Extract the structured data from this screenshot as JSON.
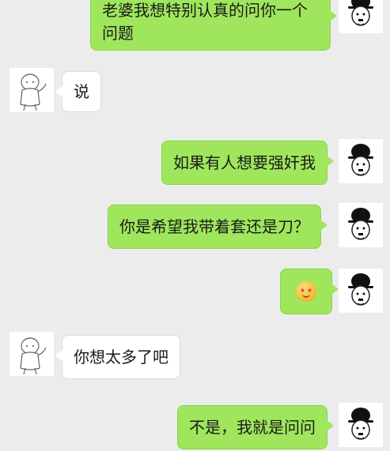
{
  "messages": [
    {
      "side": "me",
      "text": "老婆我想特别认真的问你一个问题"
    },
    {
      "side": "other",
      "text": "说"
    },
    {
      "side": "me",
      "text": "如果有人想要强奸我"
    },
    {
      "side": "me",
      "text": "你是希望我带着套还是刀？"
    },
    {
      "side": "me",
      "type": "emoji",
      "emoji": "star-struck-emoji"
    },
    {
      "side": "other",
      "text": "你想太多了吧"
    },
    {
      "side": "me",
      "text": "不是，我就是问问"
    }
  ],
  "avatars": {
    "me": "chaplin-avatar",
    "other": "sketch-character-avatar"
  },
  "colors": {
    "background": "#ececec",
    "my_bubble": "#9fe65d",
    "other_bubble": "#ffffff"
  }
}
